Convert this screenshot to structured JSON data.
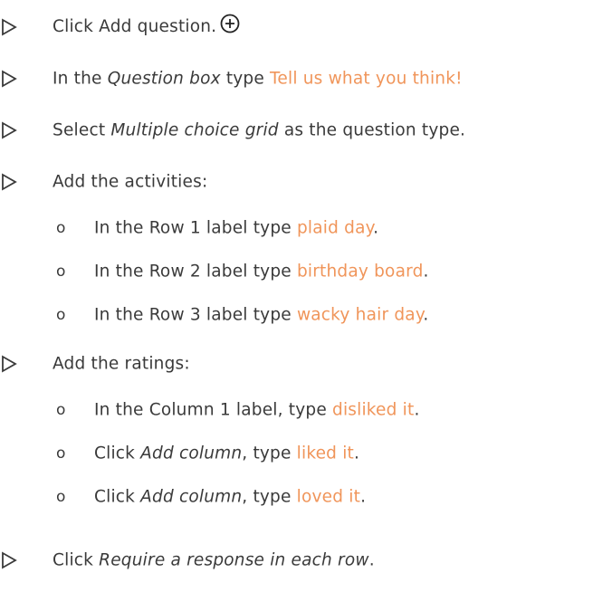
{
  "colors": {
    "accent": "#f0955a",
    "text": "#3a3a3a"
  },
  "steps": {
    "s1": {
      "pre": "Click Add question.",
      "icon": "plus-circle-icon"
    },
    "s2": {
      "pre": "In the ",
      "em": "Question box",
      "mid": " type ",
      "accent": "Tell us what you think!"
    },
    "s3": {
      "pre": "Select ",
      "em": "Multiple choice grid",
      "post": " as the question type."
    },
    "s4": {
      "text": "Add the activities:"
    },
    "s5": {
      "text": "Add the ratings:"
    },
    "s6": {
      "pre": "Click ",
      "em": "Require a response in each row",
      "post": "."
    }
  },
  "activities": [
    {
      "bullet": "o",
      "pre": "In the Row 1 label type ",
      "accent": "plaid day",
      "post": "."
    },
    {
      "bullet": "o",
      "pre": "In the Row 2 label type ",
      "accent": "birthday board",
      "post": "."
    },
    {
      "bullet": "o",
      "pre": "In the Row 3 label type ",
      "accent": "wacky hair day",
      "post": "."
    }
  ],
  "ratings": [
    {
      "bullet": "o",
      "pre": "In the Column 1 label, type ",
      "accent": "disliked it",
      "post": "."
    },
    {
      "bullet": "o",
      "pre": "Click ",
      "em": "Add column",
      "mid": ", type ",
      "accent": "liked it",
      "post": "."
    },
    {
      "bullet": "o",
      "pre": "Click ",
      "em": "Add column",
      "mid": ", type ",
      "accent": "loved it",
      "post": "."
    }
  ]
}
